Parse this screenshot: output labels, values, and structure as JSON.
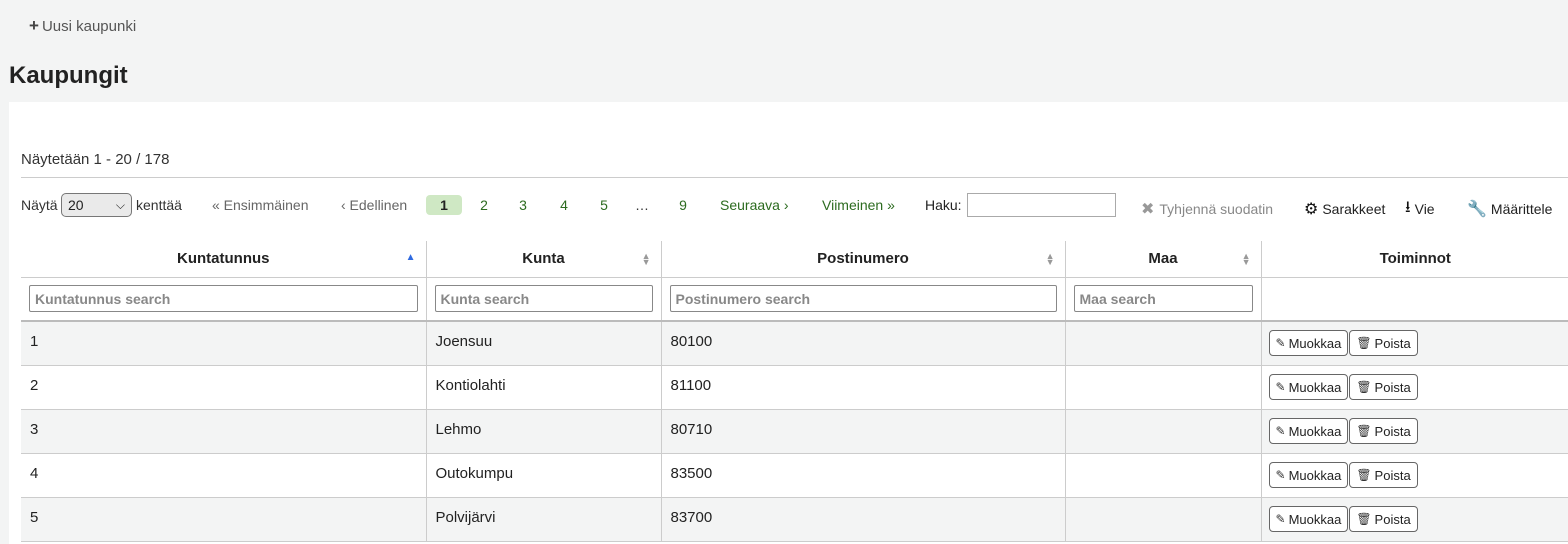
{
  "toolbar": {
    "new_label": "Uusi kaupunki"
  },
  "page_title": "Kaupungit",
  "info_text": "Näytetään 1 - 20 / 178",
  "length": {
    "label": "Näytä",
    "value": "20",
    "suffix": "kenttää"
  },
  "pagination": {
    "first": "« Ensimmäinen",
    "prev": "‹ Edellinen",
    "pages": [
      "1",
      "2",
      "3",
      "4",
      "5",
      "…",
      "9"
    ],
    "active_page": "1",
    "next": "Seuraava ›",
    "last": "Viimeinen »"
  },
  "search": {
    "label": "Haku:",
    "value": ""
  },
  "tools": {
    "clear_filter": "Tyhjennä suodatin",
    "columns": "Sarakkeet",
    "export": "Vie",
    "configure": "Määrittele"
  },
  "table": {
    "headers": [
      "Kuntatunnus",
      "Kunta",
      "Postinumero",
      "Maa",
      "Toiminnot"
    ],
    "filters": [
      "Kuntatunnus search",
      "Kunta search",
      "Postinumero search",
      "Maa search"
    ],
    "rows": [
      {
        "id": "1",
        "city": "Joensuu",
        "zip": "80100",
        "country": ""
      },
      {
        "id": "2",
        "city": "Kontiolahti",
        "zip": "81100",
        "country": ""
      },
      {
        "id": "3",
        "city": "Lehmo",
        "zip": "80710",
        "country": ""
      },
      {
        "id": "4",
        "city": "Outokumpu",
        "zip": "83500",
        "country": ""
      },
      {
        "id": "5",
        "city": "Polvijärvi",
        "zip": "83700",
        "country": ""
      }
    ],
    "edit_label": "Muokkaa",
    "delete_label": "Poista"
  }
}
